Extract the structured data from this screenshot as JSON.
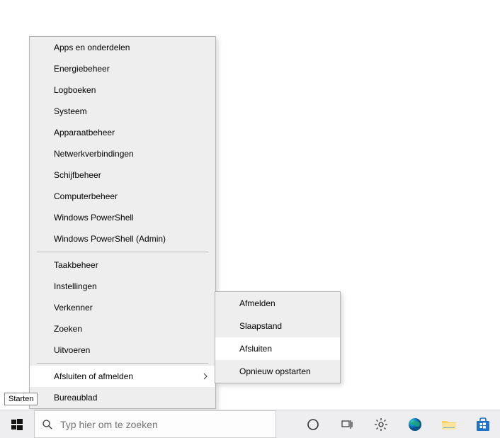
{
  "power_menu": {
    "group1": [
      "Apps en onderdelen",
      "Energiebeheer",
      "Logboeken",
      "Systeem",
      "Apparaatbeheer",
      "Netwerkverbindingen",
      "Schijfbeheer",
      "Computerbeheer",
      "Windows PowerShell",
      "Windows PowerShell (Admin)"
    ],
    "group2": [
      "Taakbeheer",
      "Instellingen",
      "Verkenner",
      "Zoeken",
      "Uitvoeren"
    ],
    "group3_submenu_label": "Afsluiten of afmelden",
    "group3_desktop": "Bureaublad"
  },
  "shutdown_submenu": [
    "Afmelden",
    "Slaapstand",
    "Afsluiten",
    "Opnieuw opstarten"
  ],
  "tooltip": "Starten",
  "search": {
    "placeholder": "Typ hier om te zoeken"
  },
  "colors": {
    "menu_bg": "#eeeeee",
    "menu_border": "#b3b3b3",
    "hover_bg": "#ffffff",
    "edge_blue": "#0c88d6",
    "explorer_yellow": "#ffd155",
    "store_blue": "#1e73c9"
  }
}
